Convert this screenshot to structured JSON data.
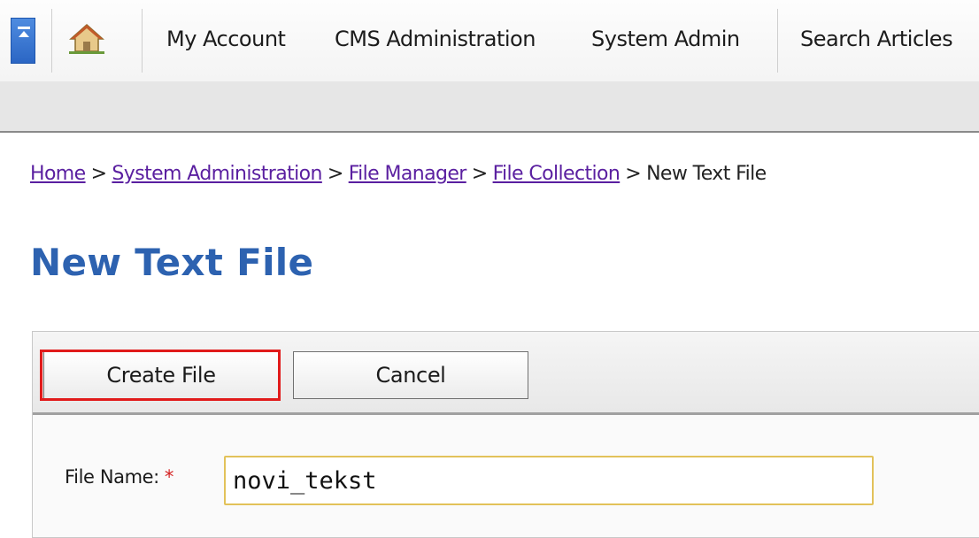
{
  "nav": {
    "items": [
      {
        "label": "My Account"
      },
      {
        "label": "CMS Administration"
      },
      {
        "label": "System Admin"
      },
      {
        "label": "Search Articles"
      }
    ]
  },
  "breadcrumb": {
    "items": [
      {
        "label": "Home"
      },
      {
        "label": "System Administration"
      },
      {
        "label": "File Manager"
      },
      {
        "label": "File Collection"
      },
      {
        "label": "New Text File"
      }
    ],
    "separator": ">"
  },
  "page": {
    "title": "New Text File"
  },
  "toolbar": {
    "create_label": "Create File",
    "cancel_label": "Cancel"
  },
  "form": {
    "file_name_label": "File Name:",
    "required_mark": "*",
    "file_name_value": "novi_tekst"
  },
  "colors": {
    "title": "#2d62b0",
    "link": "#5a1fa0",
    "highlight": "#e11b1b",
    "input_border": "#e2c25a"
  },
  "icons": {
    "collapse": "collapse-arrow-icon",
    "home": "home-icon"
  }
}
